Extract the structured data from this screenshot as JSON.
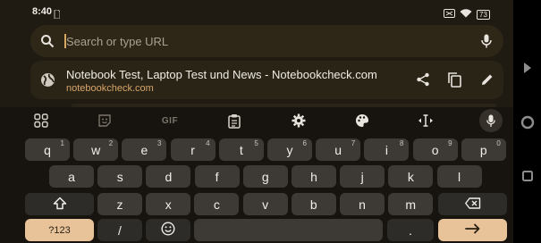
{
  "status": {
    "time": "8:40",
    "battery": "73"
  },
  "omnibox": {
    "placeholder": "Search or type URL"
  },
  "suggestion": {
    "title": "Notebook Test, Laptop Test und News - Notebookcheck.com",
    "url": "notebookcheck.com"
  },
  "toolbar": {
    "gif_label": "GIF"
  },
  "keyboard": {
    "row1": [
      {
        "k": "q",
        "h": "1"
      },
      {
        "k": "w",
        "h": "2"
      },
      {
        "k": "e",
        "h": "3"
      },
      {
        "k": "r",
        "h": "4"
      },
      {
        "k": "t",
        "h": "5"
      },
      {
        "k": "y",
        "h": "6"
      },
      {
        "k": "u",
        "h": "7"
      },
      {
        "k": "i",
        "h": "8"
      },
      {
        "k": "o",
        "h": "9"
      },
      {
        "k": "p",
        "h": "0"
      }
    ],
    "row2": [
      "a",
      "s",
      "d",
      "f",
      "g",
      "h",
      "j",
      "k",
      "l"
    ],
    "row3": [
      "z",
      "x",
      "c",
      "v",
      "b",
      "n",
      "m"
    ],
    "symbols_label": "?123",
    "slash_label": "/",
    "period_label": "."
  }
}
